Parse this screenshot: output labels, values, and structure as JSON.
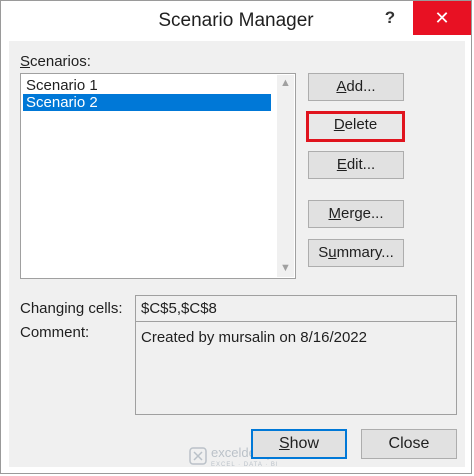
{
  "window": {
    "title": "Scenario Manager",
    "help_glyph": "?",
    "close_glyph": "✕"
  },
  "scenarios": {
    "label": "Scenarios:",
    "items": [
      {
        "label": "Scenario 1",
        "selected": false
      },
      {
        "label": "Scenario 2",
        "selected": true
      }
    ]
  },
  "buttons": {
    "add": "Add...",
    "delete": "Delete",
    "edit": "Edit...",
    "merge": "Merge...",
    "summary": "Summary..."
  },
  "changing_cells": {
    "label": "Changing cells:",
    "value": "$C$5,$C$8"
  },
  "comment": {
    "label": "Comment:",
    "value": "Created by mursalin on 8/16/2022"
  },
  "footer": {
    "show": "Show",
    "close": "Close"
  },
  "watermark": {
    "name": "exceldemy",
    "tagline": "EXCEL · DATA · BI"
  },
  "colors": {
    "selection": "#0078d7",
    "highlight_border": "#e0141e",
    "close_button": "#e81123"
  }
}
